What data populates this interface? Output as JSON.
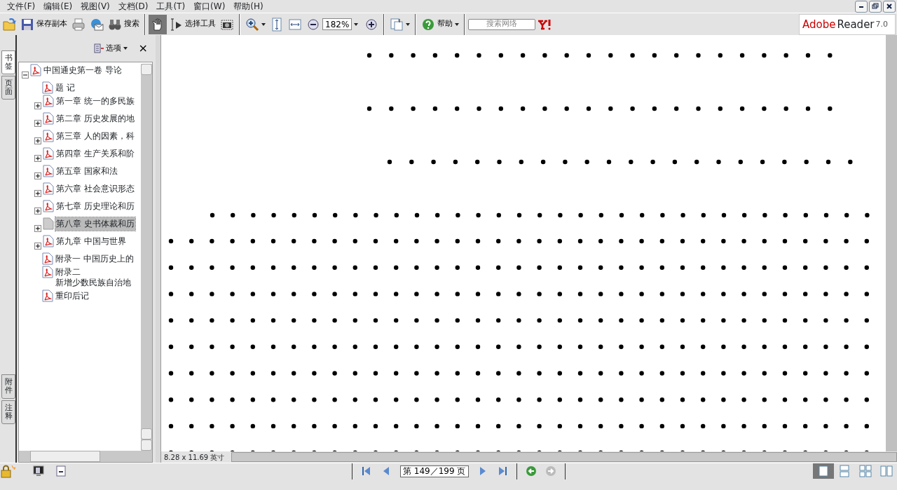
{
  "menu": [
    "文件(F)",
    "编辑(E)",
    "视图(V)",
    "文档(D)",
    "工具(T)",
    "窗口(W)",
    "帮助(H)"
  ],
  "toolbar": [
    {
      "kind": "icon"
    },
    {
      "kind": "labeled",
      "label": "保存副本"
    },
    {
      "kind": "icon"
    },
    {
      "kind": "icon"
    },
    {
      "kind": "labeled",
      "label": "搜索"
    },
    {
      "kind": "sep"
    },
    {
      "kind": "tool",
      "selected": true
    },
    {
      "kind": "tool",
      "label": "选择工具",
      "selected": false
    },
    {
      "kind": "tool",
      "selected": false
    },
    {
      "kind": "sep"
    },
    {
      "kind": "icon"
    },
    {
      "kind": "icon"
    },
    {
      "kind": "icon"
    },
    {
      "kind": "icon"
    },
    {
      "kind": "combo",
      "value": "182%"
    },
    {
      "kind": "icon"
    },
    {
      "kind": "sep"
    },
    {
      "kind": "icon"
    },
    {
      "kind": "sep"
    },
    {
      "kind": "labeled",
      "label": "帮助"
    },
    {
      "kind": "sep"
    },
    {
      "kind": "search",
      "placeholder": "搜索网络"
    },
    {
      "kind": "icon"
    }
  ],
  "logo": {
    "brand": "Adobe",
    "product": "Reader",
    "version": "7.0"
  },
  "side_tabs": [
    {
      "label": "书签",
      "selected": true
    },
    {
      "label": "页面",
      "selected": false
    },
    {
      "label": "附件",
      "selected": false
    },
    {
      "label": "注释",
      "selected": false
    }
  ],
  "panel": {
    "options": "选项",
    "close": "×"
  },
  "tree": [
    {
      "label": "中国通史第一卷 导论",
      "expanded": true,
      "selected": false,
      "children": [
        {
          "label": "题 记",
          "selected": false
        },
        {
          "label": "第一章 统一的多民族",
          "expanded": false,
          "selected": false
        },
        {
          "label": "第二章 历史发展的地",
          "expanded": false,
          "selected": false
        },
        {
          "label": "第三章 人的因素，科",
          "expanded": false,
          "selected": false
        },
        {
          "label": "第四章 生产关系和阶",
          "expanded": false,
          "selected": false
        },
        {
          "label": "第五章 国家和法",
          "expanded": false,
          "selected": false
        },
        {
          "label": "第六章 社会意识形态",
          "expanded": false,
          "selected": false
        },
        {
          "label": "第七章 历史理论和历",
          "expanded": false,
          "selected": false
        },
        {
          "label": "第八章 史书体裁和历",
          "expanded": false,
          "selected": true
        },
        {
          "label": "第九章 中国与世界",
          "expanded": false,
          "selected": false
        },
        {
          "label": "附录一 中国历史上的",
          "selected": false
        },
        {
          "label": "附录二",
          "sublabel": "新增少数民族自治地",
          "selected": false
        },
        {
          "label": "重印后记",
          "selected": false
        }
      ]
    }
  ],
  "page_size": "8.28 x 11.69 英寸",
  "page_field": "第 149／199 页",
  "views": [
    {
      "selected": true
    },
    {
      "selected": false
    },
    {
      "selected": false
    },
    {
      "selected": false
    }
  ]
}
